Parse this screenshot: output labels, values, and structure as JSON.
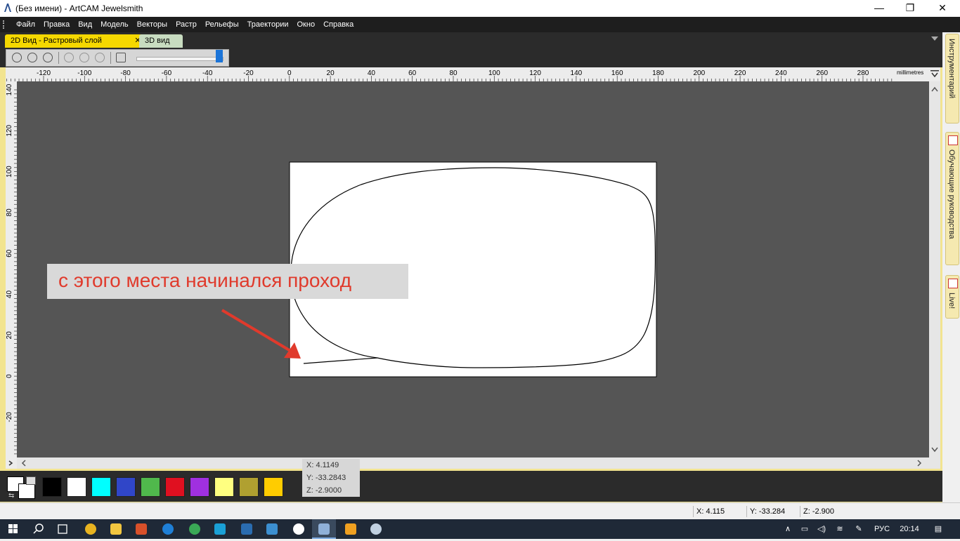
{
  "window": {
    "title": "(Без имени) - ArtCAM Jewelsmith",
    "minimize_glyph": "—",
    "maximize_glyph": "❐",
    "close_glyph": "✕"
  },
  "menu": [
    "Файл",
    "Правка",
    "Вид",
    "Модель",
    "Векторы",
    "Растр",
    "Рельефы",
    "Траектории",
    "Окно",
    "Справка"
  ],
  "tabs": [
    {
      "label": "2D Вид - Растровый слой",
      "active": true,
      "close": "✕"
    },
    {
      "label": "3D вид",
      "active": false
    }
  ],
  "toolbar": {
    "icons": [
      "zoom-in-icon",
      "zoom-out-icon",
      "zoom-previous-icon",
      "zoom-box-icon",
      "zoom-fit-icon",
      "zoom-reset-icon",
      "raster-settings-icon"
    ],
    "slider_level": 1.0
  },
  "ruler": {
    "units": "millimetres",
    "h_ticks": [
      "-120",
      "-100",
      "-80",
      "-60",
      "-40",
      "-20",
      "0",
      "20",
      "40",
      "60",
      "80",
      "100",
      "120",
      "140",
      "160",
      "180",
      "200",
      "220",
      "240",
      "260",
      "280"
    ],
    "v_ticks": [
      "140",
      "120",
      "100",
      "80",
      "60",
      "40",
      "20",
      "0",
      "-20"
    ]
  },
  "annotation": {
    "text": "с этого места начинался проход",
    "color": "#e03a2c"
  },
  "palette": [
    "#000000",
    "#ffffff",
    "#00ffff",
    "#3046c8",
    "#50b84c",
    "#e01020",
    "#a030e0",
    "#ffff80",
    "#b0a030",
    "#ffcc00"
  ],
  "cursor_popup": {
    "x": "X: 4.1149",
    "y": "Y: -33.2843",
    "z": "Z: -2.9000"
  },
  "status": {
    "x": "X: 4.115",
    "y": "Y: -33.284",
    "z": "Z: -2.900"
  },
  "dock_tabs": [
    "Инструментарий",
    "Обучающие руководства",
    "Live!"
  ],
  "taskbar": {
    "apps": [
      "start-icon",
      "search-icon",
      "task-view-icon",
      "chrome-icon",
      "explorer-icon",
      "app-icon",
      "edge-icon",
      "chrome-icon-2",
      "ccleaner-icon",
      "3d-icon",
      "photos-icon",
      "yandex-icon",
      "artcam-icon",
      "app-icon-2",
      "paint-icon"
    ],
    "lang": "РУС",
    "time": "20:14"
  }
}
